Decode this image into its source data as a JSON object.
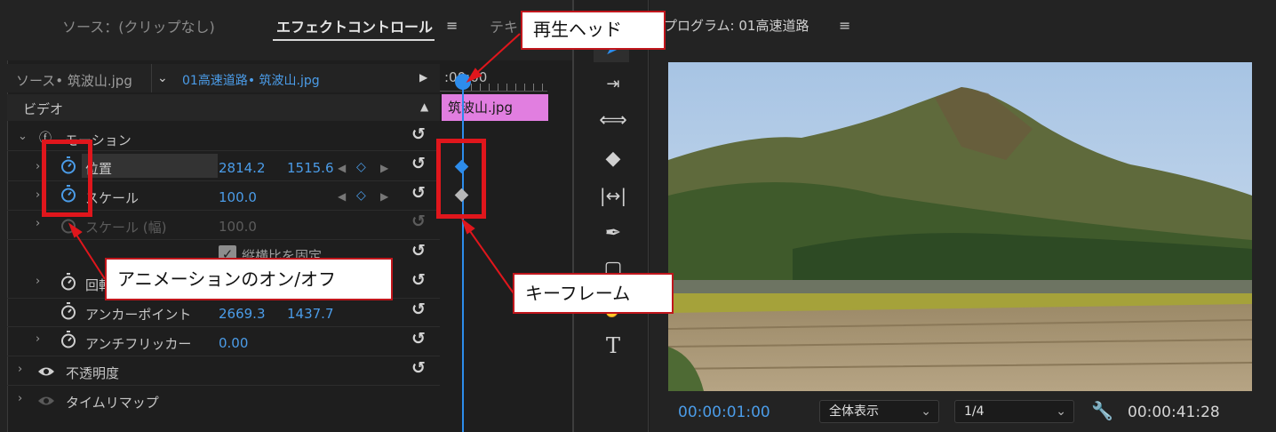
{
  "effect_controls": {
    "tabs": {
      "source": "ソース：(クリップなし)",
      "effect_controls": "エフェクトコントロール",
      "text": "テキ"
    },
    "clip_source": "ソース• 筑波山.jpg",
    "clip_sequence": "01高速道路• 筑波山.jpg",
    "timecode": ":00:00",
    "clip_bar_label": "筑波山.jpg",
    "video_section": "ビデオ",
    "motion": "モーション",
    "properties": [
      {
        "name": "位置",
        "v1": "2814.2",
        "v2": "1515.6"
      },
      {
        "name": "スケール",
        "v1": "100.0"
      },
      {
        "name": "スケール (幅)",
        "v1": "100.0"
      },
      {
        "name": "縦横比を固定"
      },
      {
        "name": "回転"
      },
      {
        "name": "アンカーポイント",
        "v1": "2669.3",
        "v2": "1437.7"
      },
      {
        "name": "アンチフリッカー",
        "v1": "0.00"
      }
    ],
    "opacity": "不透明度",
    "time_remap": "タイムリマップ"
  },
  "program": {
    "title": "プログラム: 01高速道路",
    "timecode_current": "00:00:01:00",
    "zoom": "全体表示",
    "resolution": "1/4",
    "timecode_total": "00:00:41:28"
  },
  "callouts": {
    "playhead": "再生ヘッド",
    "animation_toggle": "アニメーションのオン/オフ",
    "keyframe": "キーフレーム"
  },
  "colors": {
    "accent": "#4b9ce8",
    "clip": "#e17ee0",
    "callout_border": "#e0161c"
  }
}
